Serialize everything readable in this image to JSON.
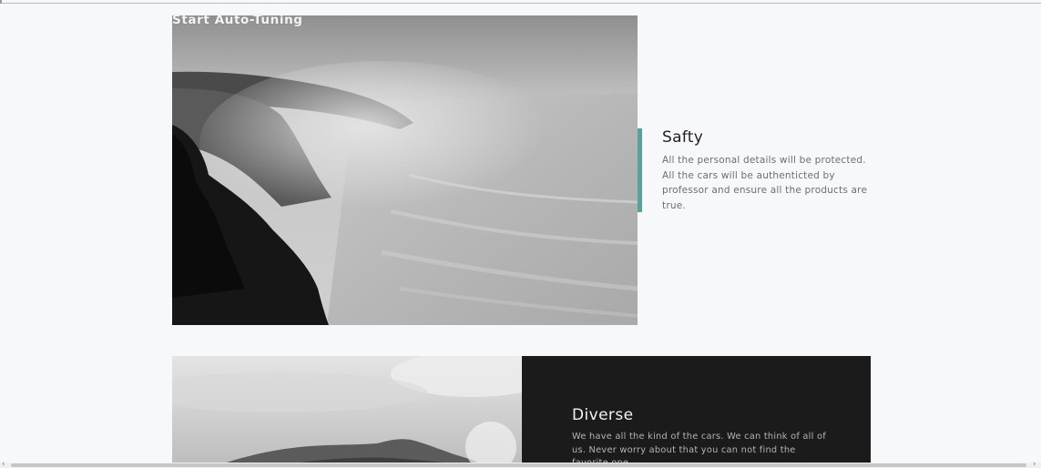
{
  "hero": {
    "overlay_title": "Start Auto-Tuning",
    "image_icon": "misty-coastline-image"
  },
  "features": [
    {
      "heading": "Safty",
      "text": "All the personal details will be protected. All the cars will be authenticted by professor and ensure all the products are true.",
      "accent_color": "#5e9f9b"
    },
    {
      "heading": "Diverse",
      "text": "We have all the kind of the cars. We can think of all of us. Never worry about that you can not find the favorite one.",
      "panel_color": "#1b1b1b",
      "image_icon": "mountain-landscape-image"
    }
  ],
  "scrollbar": {
    "left_arrow": "‹",
    "right_arrow": "›"
  }
}
